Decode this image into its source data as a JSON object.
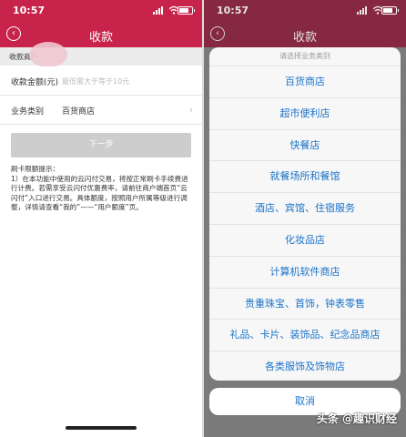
{
  "status_bar": {
    "time": "10:57",
    "location_icon": "location-arrow-icon"
  },
  "left": {
    "title": "收款",
    "merchant_label": "收款商户",
    "amount": {
      "label": "收款金额(元)",
      "placeholder": "最低需大于等于10元"
    },
    "category": {
      "label": "业务类别",
      "value": "百货商店"
    },
    "next_label": "下一步",
    "tips": [
      "刷卡限额提示：",
      "1）在本功能中使用的云闪付交易，将按正常刷卡手续费进行计费。若需享受云闪付优惠费率，请前往商户端首页“云闪付”入口进行交易。具体额度，按照用户所属等级进行调整，详情请查看“我的”——“用户额度”页。"
    ]
  },
  "right": {
    "title": "收款",
    "sheet_title": "请选择业务类别",
    "options": [
      "百货商店",
      "超市便利店",
      "快餐店",
      "就餐场所和餐馆",
      "酒店、宾馆、住宿服务",
      "化妆品店",
      "计算机软件商店",
      "贵重珠宝、首饰，钟表零售",
      "礼品、卡片、装饰品、纪念品商店",
      "各类服饰及饰物店"
    ],
    "cancel_label": "取消"
  },
  "watermark": "头条 @趣识财经",
  "colors": {
    "header_red": "#c8234a",
    "link_blue": "#1a73c9"
  }
}
